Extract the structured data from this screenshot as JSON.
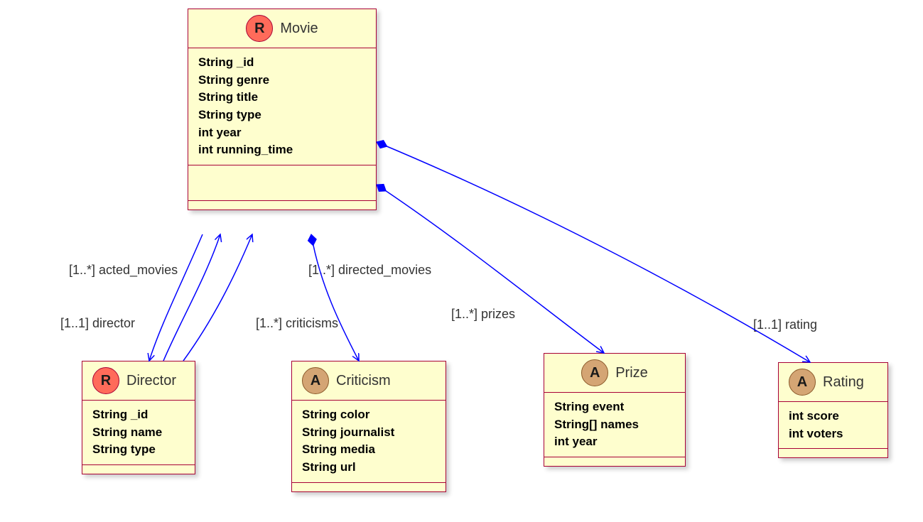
{
  "classes": {
    "movie": {
      "badge": "R",
      "name": "Movie",
      "attrs": [
        "String _id",
        "String genre",
        "String title",
        "String type",
        "int year",
        "int running_time"
      ]
    },
    "director": {
      "badge": "R",
      "name": "Director",
      "attrs": [
        "String _id",
        "String name",
        "String type"
      ]
    },
    "criticism": {
      "badge": "A",
      "name": "Criticism",
      "attrs": [
        "String color",
        "String journalist",
        "String media",
        "String url"
      ]
    },
    "prize": {
      "badge": "A",
      "name": "Prize",
      "attrs": [
        "String event",
        "String[] names",
        "int year"
      ]
    },
    "rating": {
      "badge": "A",
      "name": "Rating",
      "attrs": [
        "int score",
        "int voters"
      ]
    }
  },
  "relations": {
    "acted_movies": "[1..*] acted_movies",
    "director": "[1..1] director",
    "directed_movies": "[1..*] directed_movies",
    "criticisms": "[1..*] criticisms",
    "prizes": "[1..*] prizes",
    "rating": "[1..1] rating"
  },
  "chart_data": {
    "type": "uml_class_diagram",
    "entities": [
      {
        "id": "Movie",
        "stereotype": "R",
        "attributes": [
          "String _id",
          "String genre",
          "String title",
          "String type",
          "int year",
          "int running_time"
        ]
      },
      {
        "id": "Director",
        "stereotype": "R",
        "attributes": [
          "String _id",
          "String name",
          "String type"
        ]
      },
      {
        "id": "Criticism",
        "stereotype": "A",
        "attributes": [
          "String color",
          "String journalist",
          "String media",
          "String url"
        ]
      },
      {
        "id": "Prize",
        "stereotype": "A",
        "attributes": [
          "String event",
          "String[] names",
          "int year"
        ]
      },
      {
        "id": "Rating",
        "stereotype": "A",
        "attributes": [
          "int score",
          "int voters"
        ]
      }
    ],
    "relationships": [
      {
        "from": "Director",
        "to": "Movie",
        "label": "acted_movies",
        "multiplicity": "1..*",
        "type": "association"
      },
      {
        "from": "Movie",
        "to": "Director",
        "label": "director",
        "multiplicity": "1..1",
        "type": "association"
      },
      {
        "from": "Director",
        "to": "Movie",
        "label": "directed_movies",
        "multiplicity": "1..*",
        "type": "association"
      },
      {
        "from": "Movie",
        "to": "Criticism",
        "label": "criticisms",
        "multiplicity": "1..*",
        "type": "composition"
      },
      {
        "from": "Movie",
        "to": "Prize",
        "label": "prizes",
        "multiplicity": "1..*",
        "type": "composition"
      },
      {
        "from": "Movie",
        "to": "Rating",
        "label": "rating",
        "multiplicity": "1..1",
        "type": "composition"
      }
    ]
  }
}
